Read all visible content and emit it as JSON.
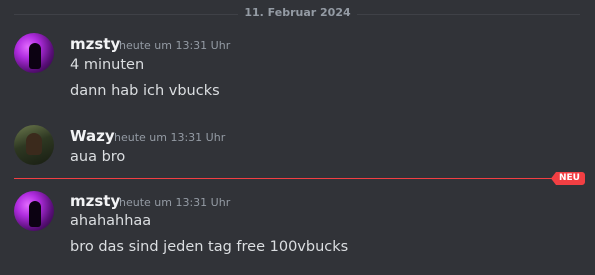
{
  "date_divider": "11. Februar 2024",
  "new_badge": "NEU",
  "messages": [
    {
      "author": "mzsty",
      "timestamp": "heute um 13:31 Uhr",
      "lines": [
        "4 minuten",
        "dann hab ich vbucks"
      ]
    },
    {
      "author": "Wazy",
      "timestamp": "heute um 13:31 Uhr",
      "lines": [
        "aua bro"
      ]
    },
    {
      "author": "mzsty",
      "timestamp": "heute um 13:31 Uhr",
      "lines": [
        "ahahahhaa",
        "bro das sind jeden tag free 100vbucks"
      ]
    }
  ],
  "colors": {
    "background": "#313338",
    "new_divider": "#f23f43",
    "username": "#f2f3f5",
    "muted": "#949ba4"
  }
}
